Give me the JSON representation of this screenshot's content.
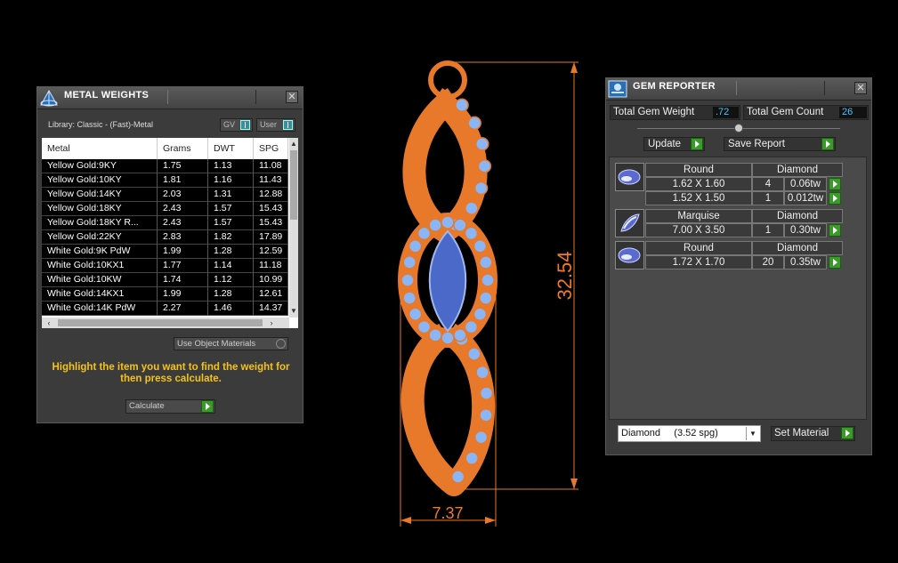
{
  "metal_panel": {
    "title": "METAL WEIGHTS",
    "close": "✕",
    "library": "Library: Classic - (Fast)-Metal",
    "toggle_gv": "GV",
    "toggle_user": "User",
    "columns": [
      "Metal",
      "Grams",
      "DWT",
      "SPG"
    ],
    "rows": [
      [
        "Yellow Gold:9KY",
        "1.75",
        "1.13",
        "11.08"
      ],
      [
        "Yellow Gold:10KY",
        "1.81",
        "1.16",
        "11.43"
      ],
      [
        "Yellow Gold:14KY",
        "2.03",
        "1.31",
        "12.88"
      ],
      [
        "Yellow Gold:18KY",
        "2.43",
        "1.57",
        "15.43"
      ],
      [
        "Yellow Gold:18KY R...",
        "2.43",
        "1.57",
        "15.43"
      ],
      [
        "Yellow Gold:22KY",
        "2.83",
        "1.82",
        "17.89"
      ],
      [
        "White Gold:9K PdW",
        "1.99",
        "1.28",
        "12.59"
      ],
      [
        "White Gold:10KX1",
        "1.77",
        "1.14",
        "11.18"
      ],
      [
        "White Gold:10KW",
        "1.74",
        "1.12",
        "10.99"
      ],
      [
        "White Gold:14KX1",
        "1.99",
        "1.28",
        "12.61"
      ],
      [
        "White Gold:14K PdW",
        "2.27",
        "1.46",
        "14.37"
      ]
    ],
    "use_object_materials": "Use Object Materials",
    "hint": "Highlight the item you want to find the weight for then press calculate.",
    "calculate": "Calculate"
  },
  "gem_panel": {
    "title": "GEM REPORTER",
    "close": "✕",
    "total_weight_label": "Total Gem Weight",
    "total_weight_value": ".72",
    "total_count_label": "Total Gem Count",
    "total_count_value": "26",
    "update": "Update",
    "save_report": "Save Report",
    "groups": [
      {
        "shape": "Round",
        "material": "Diamond",
        "lines": [
          {
            "size": "1.62 X 1.60",
            "count": "4",
            "weight": "0.06tw"
          },
          {
            "size": "1.52 X 1.50",
            "count": "1",
            "weight": "0.012tw"
          }
        ]
      },
      {
        "shape": "Marquise",
        "material": "Diamond",
        "lines": [
          {
            "size": "7.00 X 3.50",
            "count": "1",
            "weight": "0.30tw"
          }
        ]
      },
      {
        "shape": "Round",
        "material": "Diamond",
        "lines": [
          {
            "size": "1.72 X 1.70",
            "count": "20",
            "weight": "0.35tw"
          }
        ]
      }
    ],
    "material_select": "Diamond     (3.52 spg)",
    "set_material": "Set Material"
  },
  "viewport": {
    "height_dim": "32.54",
    "width_dim": "7.37",
    "metal_color": "#e8782a",
    "stone_color": "#8ab6f5",
    "center_stone_color": "#4b69c9"
  }
}
